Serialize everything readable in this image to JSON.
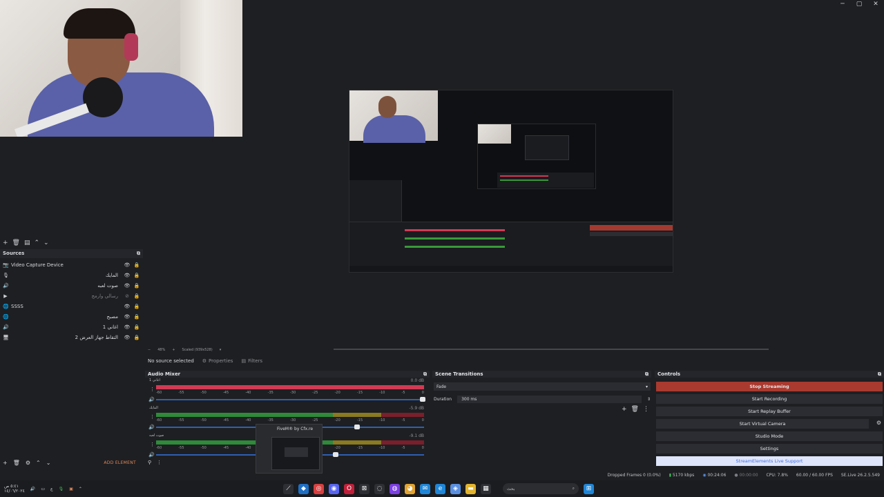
{
  "window": {
    "controls": [
      "─",
      "▢",
      "✕"
    ]
  },
  "sources": {
    "title": "Sources",
    "items": [
      {
        "icon": "📷",
        "name": "Video Capture Device",
        "hidden": false
      },
      {
        "icon": "🎙",
        "name": "المايك",
        "hidden": false
      },
      {
        "icon": "🔊",
        "name": "صوت لعبه",
        "hidden": false
      },
      {
        "icon": "▶",
        "name": "رسالي وارمج",
        "hidden": true
      },
      {
        "icon": "🌐",
        "name": "SSSS",
        "hidden": false
      },
      {
        "icon": "🌐",
        "name": "مصبح",
        "hidden": false
      },
      {
        "icon": "🔊",
        "name": "اغاني 1",
        "hidden": false
      },
      {
        "icon": "🖥",
        "name": "التقاط جهاز العرض 2",
        "hidden": false
      }
    ],
    "add_element": "ADD ELEMENT"
  },
  "zoom": {
    "level": "48%",
    "scale_label": "Scaled (939x528)"
  },
  "properties_bar": {
    "no_source": "No source selected",
    "properties": "Properties",
    "filters": "Filters"
  },
  "mixer": {
    "title": "Audio Mixer",
    "ticks": [
      "-60",
      "-55",
      "-50",
      "-45",
      "-40",
      "-35",
      "-30",
      "-25",
      "-20",
      "-15",
      "-10",
      "-5",
      "0"
    ],
    "channels": [
      {
        "name": "اغاني 1",
        "db": "0.0 dB",
        "level": 0.0
      },
      {
        "name": "المايك",
        "db": "-5.9 dB",
        "level": 0.74
      },
      {
        "name": "صوت لعبه",
        "db": "-9.1 dB",
        "level": 0.66
      }
    ]
  },
  "fivem_tooltip": "FiveM® by Cfx.re",
  "transitions": {
    "title": "Scene Transitions",
    "selected": "Fade",
    "duration_label": "Duration",
    "duration_value": "300 ms"
  },
  "controls": {
    "title": "Controls",
    "stop_streaming": "Stop Streaming",
    "start_recording": "Start Recording",
    "start_replay": "Start Replay Buffer",
    "start_vcam": "Start Virtual Camera",
    "studio_mode": "Studio Mode",
    "settings": "Settings",
    "streamelements": "StreamElements Live Support"
  },
  "status": {
    "dropped": "Dropped Frames 0 (0.0%)",
    "bitrate": "5170 kbps",
    "live_time": "00:24:06",
    "rec_time": "00:00:00",
    "cpu": "CPU: 7.8%",
    "fps": "60.00 / 60.00 FPS",
    "version": "SE.Live 26.2.5.549"
  },
  "taskbar": {
    "time": "٥:٤١ ص",
    "date": "١٤/٠٦/٢٠٢٤",
    "search_placeholder": "بحث"
  }
}
